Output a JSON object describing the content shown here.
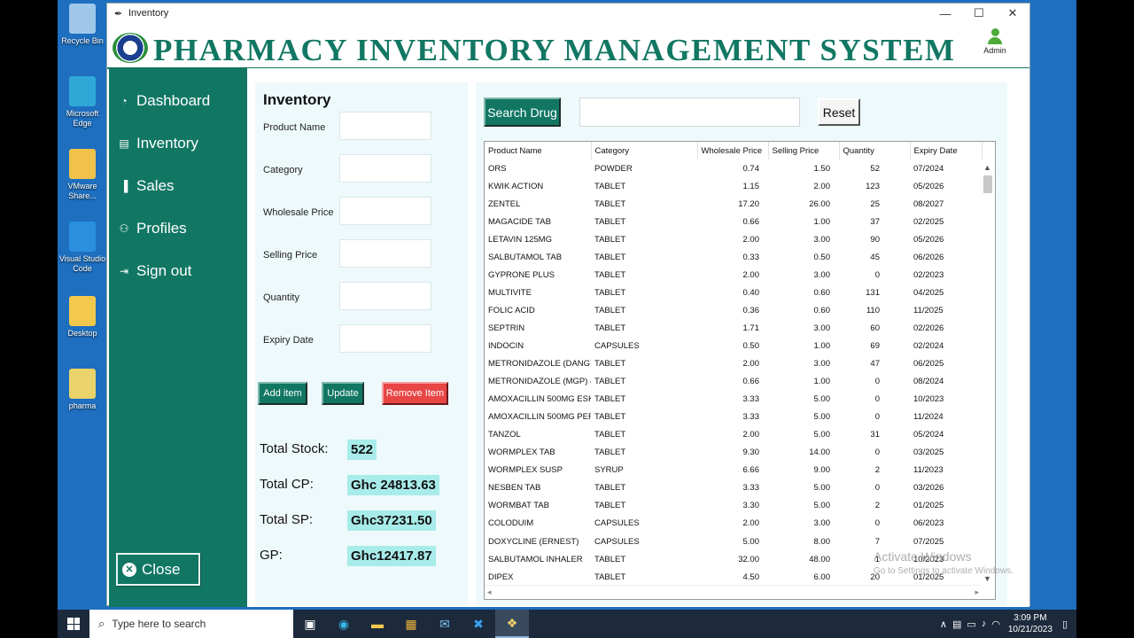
{
  "desktop": {
    "icons": [
      {
        "label": "Recycle Bin",
        "color": "#9fc7ea"
      },
      {
        "label": "Microsoft Edge",
        "color": "#2fa8d8"
      },
      {
        "label": "VMware Share...",
        "color": "#f0c24a"
      },
      {
        "label": "Visual Studio Code",
        "color": "#2b8fe0"
      },
      {
        "label": "Desktop",
        "color": "#f2c94c"
      },
      {
        "label": "pharma",
        "color": "#e9d36a"
      }
    ]
  },
  "window": {
    "title": "Inventory",
    "controls": {
      "minimize": "—",
      "maximize": "☐",
      "close": "✕"
    }
  },
  "header": {
    "app_title": "PHARMACY INVENTORY MANAGEMENT SYSTEM",
    "user_label": "Admin"
  },
  "sidebar": {
    "items": [
      {
        "label": "Dashboard",
        "icon": "pie-icon"
      },
      {
        "label": "Inventory",
        "icon": "list-icon"
      },
      {
        "label": "Sales",
        "icon": "bar-chart-icon"
      },
      {
        "label": "Profiles",
        "icon": "users-icon"
      },
      {
        "label": "Sign out",
        "icon": "sign-out-icon"
      }
    ],
    "close_label": "Close"
  },
  "form": {
    "title": "Inventory",
    "fields": {
      "product_name": {
        "label": "Product Name",
        "value": ""
      },
      "category": {
        "label": "Category",
        "value": ""
      },
      "wholesale_price": {
        "label": "Wholesale Price",
        "value": ""
      },
      "selling_price": {
        "label": "Selling Price",
        "value": ""
      },
      "quantity": {
        "label": "Quantity",
        "value": ""
      },
      "expiry_date": {
        "label": "Expiry Date",
        "value": ""
      }
    },
    "buttons": {
      "add": "Add item",
      "update": "Update",
      "remove": "Remove Item"
    },
    "totals": {
      "stock_label": "Total Stock:",
      "stock_value": "522",
      "cp_label": "Total CP:",
      "cp_value": "Ghc 24813.63",
      "sp_label": "Total SP:",
      "sp_value": "Ghc37231.50",
      "gp_label": "GP:",
      "gp_value": "Ghc12417.87"
    }
  },
  "search": {
    "button": "Search Drug",
    "value": "",
    "reset": "Reset"
  },
  "table": {
    "columns": [
      "Product Name",
      "Category",
      "Wholesale Price",
      "Selling Price",
      "Quantity",
      "Expiry Date"
    ],
    "rows": [
      [
        "ORS",
        "POWDER",
        "0.74",
        "1.50",
        "52",
        "07/2024"
      ],
      [
        "KWIK ACTION",
        "TABLET",
        "1.15",
        "2.00",
        "123",
        "05/2026"
      ],
      [
        "ZENTEL",
        "TABLET",
        "17.20",
        "26.00",
        "25",
        "08/2027"
      ],
      [
        "MAGACIDE TAB",
        "TABLET",
        "0.66",
        "1.00",
        "37",
        "02/2025"
      ],
      [
        "LETAVIN 125MG",
        "TABLET",
        "2.00",
        "3.00",
        "90",
        "05/2026"
      ],
      [
        "SALBUTAMOL TAB",
        "TABLET",
        "0.33",
        "0.50",
        "45",
        "06/2026"
      ],
      [
        "GYPRONE PLUS",
        "TABLET",
        "2.00",
        "3.00",
        "0",
        "02/2023"
      ],
      [
        "MULTIVITE",
        "TABLET",
        "0.40",
        "0.60",
        "131",
        "04/2025"
      ],
      [
        "FOLIC ACID",
        "TABLET",
        "0.36",
        "0.60",
        "110",
        "11/2025"
      ],
      [
        "SEPTRIN",
        "TABLET",
        "1.71",
        "3.00",
        "60",
        "02/2026"
      ],
      [
        "INDOCIN",
        "CAPSULES",
        "0.50",
        "1.00",
        "69",
        "02/2024"
      ],
      [
        "METRONIDAZOLE (DANGY",
        "TABLET",
        "2.00",
        "3.00",
        "47",
        "06/2025"
      ],
      [
        "METRONIDAZOLE (MGP) 4",
        "TABLET",
        "0.66",
        "1.00",
        "0",
        "08/2024"
      ],
      [
        "AMOXACILLIN 500MG ESK/",
        "TABLET",
        "3.33",
        "5.00",
        "0",
        "10/2023"
      ],
      [
        "AMOXACILLIN 500MG PER",
        "TABLET",
        "3.33",
        "5.00",
        "0",
        "11/2024"
      ],
      [
        "TANZOL",
        "TABLET",
        "2.00",
        "5.00",
        "31",
        "05/2024"
      ],
      [
        "WORMPLEX TAB",
        "TABLET",
        "9.30",
        "14.00",
        "0",
        "03/2025"
      ],
      [
        "WORMPLEX SUSP",
        "SYRUP",
        "6.66",
        "9.00",
        "2",
        "11/2023"
      ],
      [
        "NESBEN TAB",
        "TABLET",
        "3.33",
        "5.00",
        "0",
        "03/2026"
      ],
      [
        "WORMBAT TAB",
        "TABLET",
        "3.30",
        "5.00",
        "2",
        "01/2025"
      ],
      [
        "COLODUIM",
        "CAPSULES",
        "2.00",
        "3.00",
        "0",
        "06/2023"
      ],
      [
        "DOXYCLINE (ERNEST)",
        "CAPSULES",
        "5.00",
        "8.00",
        "7",
        "07/2025"
      ],
      [
        "SALBUTAMOL INHALER",
        "TABLET",
        "32.00",
        "48.00",
        "1",
        "10/2023"
      ],
      [
        "DIPEX",
        "TABLET",
        "4.50",
        "6.00",
        "20",
        "01/2025"
      ]
    ]
  },
  "watermark": {
    "line1": "Activate Windows",
    "line2": "Go to Settings to activate Windows."
  },
  "taskbar": {
    "search_placeholder": "Type here to search",
    "time": "3:09 PM",
    "date": "10/21/2023"
  },
  "colors": {
    "brand": "#117763",
    "panel": "#eef9fb",
    "total_highlight": "#a8ecea",
    "danger": "#e84545"
  }
}
